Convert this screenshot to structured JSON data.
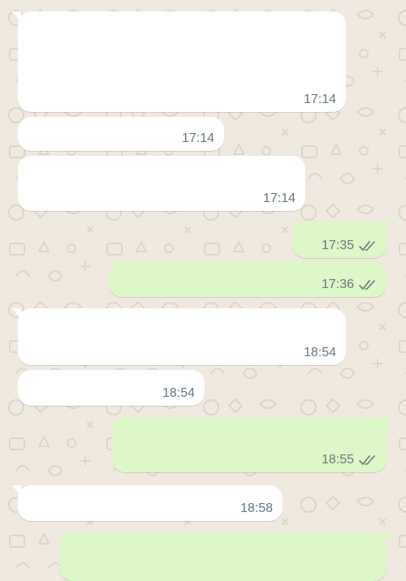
{
  "colors": {
    "chat_background": "#efe9df",
    "incoming_bubble": "#ffffff",
    "outgoing_bubble": "#dcf8c6",
    "timestamp": "#667781",
    "read_ticks": "#667781"
  },
  "messages": [
    {
      "direction": "incoming",
      "time": "17:14"
    },
    {
      "direction": "incoming",
      "time": "17:14"
    },
    {
      "direction": "incoming",
      "time": "17:14"
    },
    {
      "direction": "outgoing",
      "time": "17:35",
      "status_icon": "double-check-icon"
    },
    {
      "direction": "outgoing",
      "time": "17:36",
      "status_icon": "double-check-icon"
    },
    {
      "direction": "incoming",
      "time": "18:54"
    },
    {
      "direction": "incoming",
      "time": "18:54"
    },
    {
      "direction": "outgoing",
      "time": "18:55",
      "status_icon": "double-check-icon"
    },
    {
      "direction": "incoming",
      "time": "18:58"
    },
    {
      "direction": "outgoing"
    }
  ]
}
